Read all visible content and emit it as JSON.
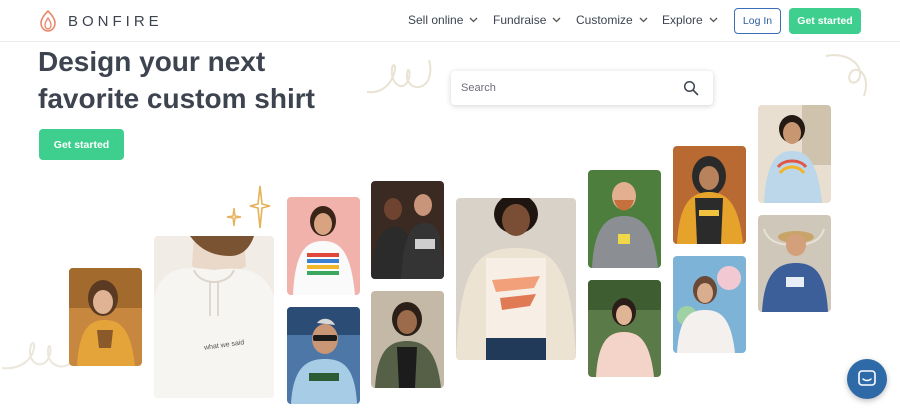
{
  "brand": {
    "name": "BONFIRE",
    "accent": "#3ecf8e",
    "login_border": "#3a6fb5"
  },
  "nav": {
    "links": [
      {
        "label": "Sell online"
      },
      {
        "label": "Fundraise"
      },
      {
        "label": "Customize"
      },
      {
        "label": "Explore"
      }
    ],
    "login_label": "Log In",
    "cta_label": "Get started"
  },
  "hero": {
    "headline_line1": "Design your next",
    "headline_line2": "favorite custom shirt",
    "cta_label": "Get started"
  },
  "search": {
    "placeholder": "Search",
    "icon": "search-icon"
  },
  "chat": {
    "icon": "chat-icon"
  },
  "gallery": {
    "hoodie_text": "what we said"
  }
}
